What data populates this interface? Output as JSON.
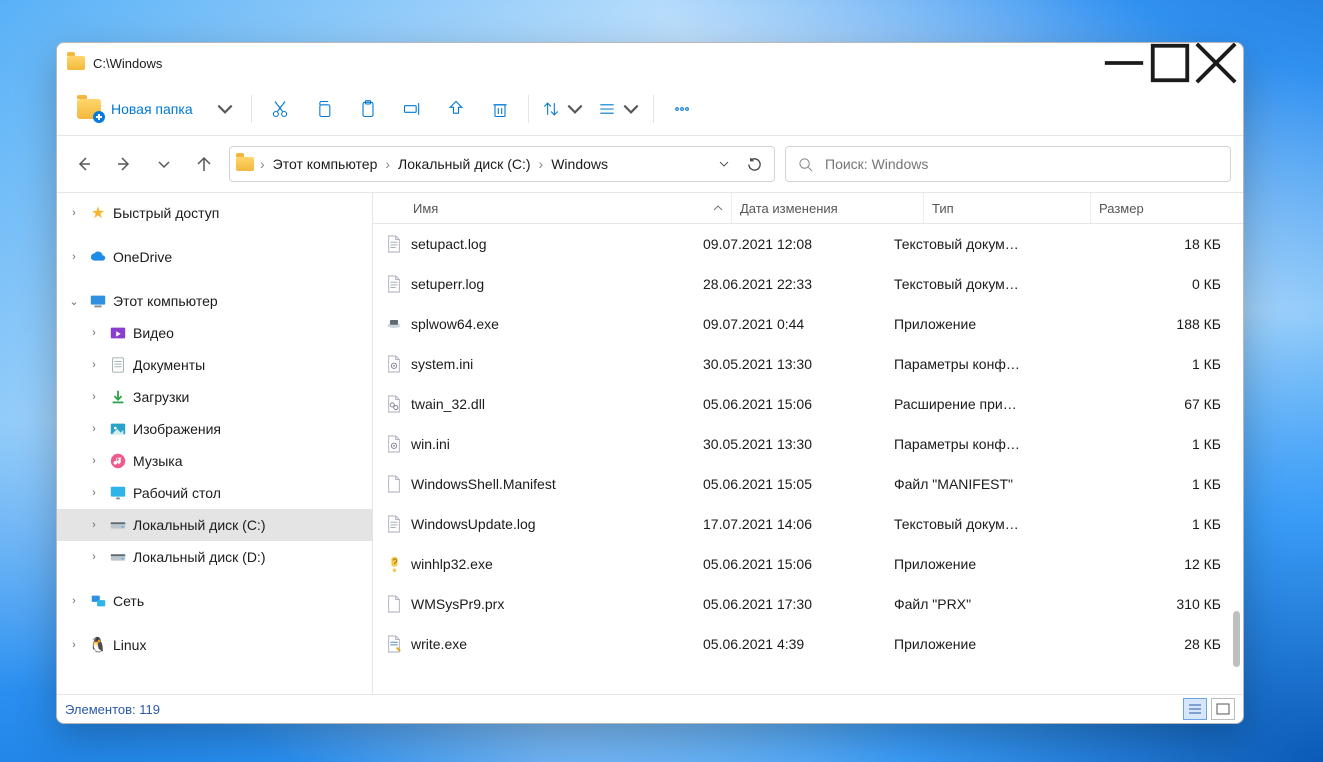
{
  "window": {
    "title": "C:\\Windows"
  },
  "toolbar": {
    "new_folder": "Новая папка"
  },
  "breadcrumb": {
    "items": [
      "Этот компьютер",
      "Локальный диск (C:)",
      "Windows"
    ]
  },
  "search": {
    "placeholder": "Поиск: Windows"
  },
  "sidebar": {
    "items": [
      {
        "id": "quick",
        "label": "Быстрый доступ",
        "level": 0,
        "twisty": "›",
        "kind": "star"
      },
      {
        "id": "gap1",
        "gap": true
      },
      {
        "id": "onedrive",
        "label": "OneDrive",
        "level": 0,
        "twisty": "›",
        "kind": "cloud"
      },
      {
        "id": "gap2",
        "gap": true
      },
      {
        "id": "thispc",
        "label": "Этот компьютер",
        "level": 0,
        "twisty": "⌄",
        "kind": "pc"
      },
      {
        "id": "videos",
        "label": "Видео",
        "level": 1,
        "twisty": "›",
        "kind": "video"
      },
      {
        "id": "docs",
        "label": "Документы",
        "level": 1,
        "twisty": "›",
        "kind": "doc"
      },
      {
        "id": "dl",
        "label": "Загрузки",
        "level": 1,
        "twisty": "›",
        "kind": "dl"
      },
      {
        "id": "pics",
        "label": "Изображения",
        "level": 1,
        "twisty": "›",
        "kind": "pic"
      },
      {
        "id": "music",
        "label": "Музыка",
        "level": 1,
        "twisty": "›",
        "kind": "music"
      },
      {
        "id": "desk",
        "label": "Рабочий стол",
        "level": 1,
        "twisty": "›",
        "kind": "desk"
      },
      {
        "id": "diskc",
        "label": "Локальный диск (C:)",
        "level": 1,
        "twisty": "›",
        "kind": "disk",
        "selected": true
      },
      {
        "id": "diskd",
        "label": "Локальный диск (D:)",
        "level": 1,
        "twisty": "›",
        "kind": "disk"
      },
      {
        "id": "gap3",
        "gap": true
      },
      {
        "id": "net",
        "label": "Сеть",
        "level": 0,
        "twisty": "›",
        "kind": "net"
      },
      {
        "id": "gap4",
        "gap": true
      },
      {
        "id": "linux",
        "label": "Linux",
        "level": 0,
        "twisty": "›",
        "kind": "linux"
      }
    ]
  },
  "columns": {
    "name": "Имя",
    "date": "Дата изменения",
    "type": "Тип",
    "size": "Размер"
  },
  "files": [
    {
      "icon": "text",
      "name": "setupact.log",
      "date": "09.07.2021 12:08",
      "type": "Текстовый докум…",
      "size": "18 КБ"
    },
    {
      "icon": "text",
      "name": "setuperr.log",
      "date": "28.06.2021 22:33",
      "type": "Текстовый докум…",
      "size": "0 КБ"
    },
    {
      "icon": "exe2",
      "name": "splwow64.exe",
      "date": "09.07.2021 0:44",
      "type": "Приложение",
      "size": "188 КБ"
    },
    {
      "icon": "ini",
      "name": "system.ini",
      "date": "30.05.2021 13:30",
      "type": "Параметры конф…",
      "size": "1 КБ"
    },
    {
      "icon": "dll",
      "name": "twain_32.dll",
      "date": "05.06.2021 15:06",
      "type": "Расширение при…",
      "size": "67 КБ"
    },
    {
      "icon": "ini",
      "name": "win.ini",
      "date": "30.05.2021 13:30",
      "type": "Параметры конф…",
      "size": "1 КБ"
    },
    {
      "icon": "file",
      "name": "WindowsShell.Manifest",
      "date": "05.06.2021 15:05",
      "type": "Файл \"MANIFEST\"",
      "size": "1 КБ"
    },
    {
      "icon": "text",
      "name": "WindowsUpdate.log",
      "date": "17.07.2021 14:06",
      "type": "Текстовый докум…",
      "size": "1 КБ"
    },
    {
      "icon": "help",
      "name": "winhlp32.exe",
      "date": "05.06.2021 15:06",
      "type": "Приложение",
      "size": "12 КБ"
    },
    {
      "icon": "file",
      "name": "WMSysPr9.prx",
      "date": "05.06.2021 17:30",
      "type": "Файл \"PRX\"",
      "size": "310 КБ"
    },
    {
      "icon": "write",
      "name": "write.exe",
      "date": "05.06.2021 4:39",
      "type": "Приложение",
      "size": "28 КБ"
    }
  ],
  "status": {
    "label": "Элементов: 119"
  }
}
